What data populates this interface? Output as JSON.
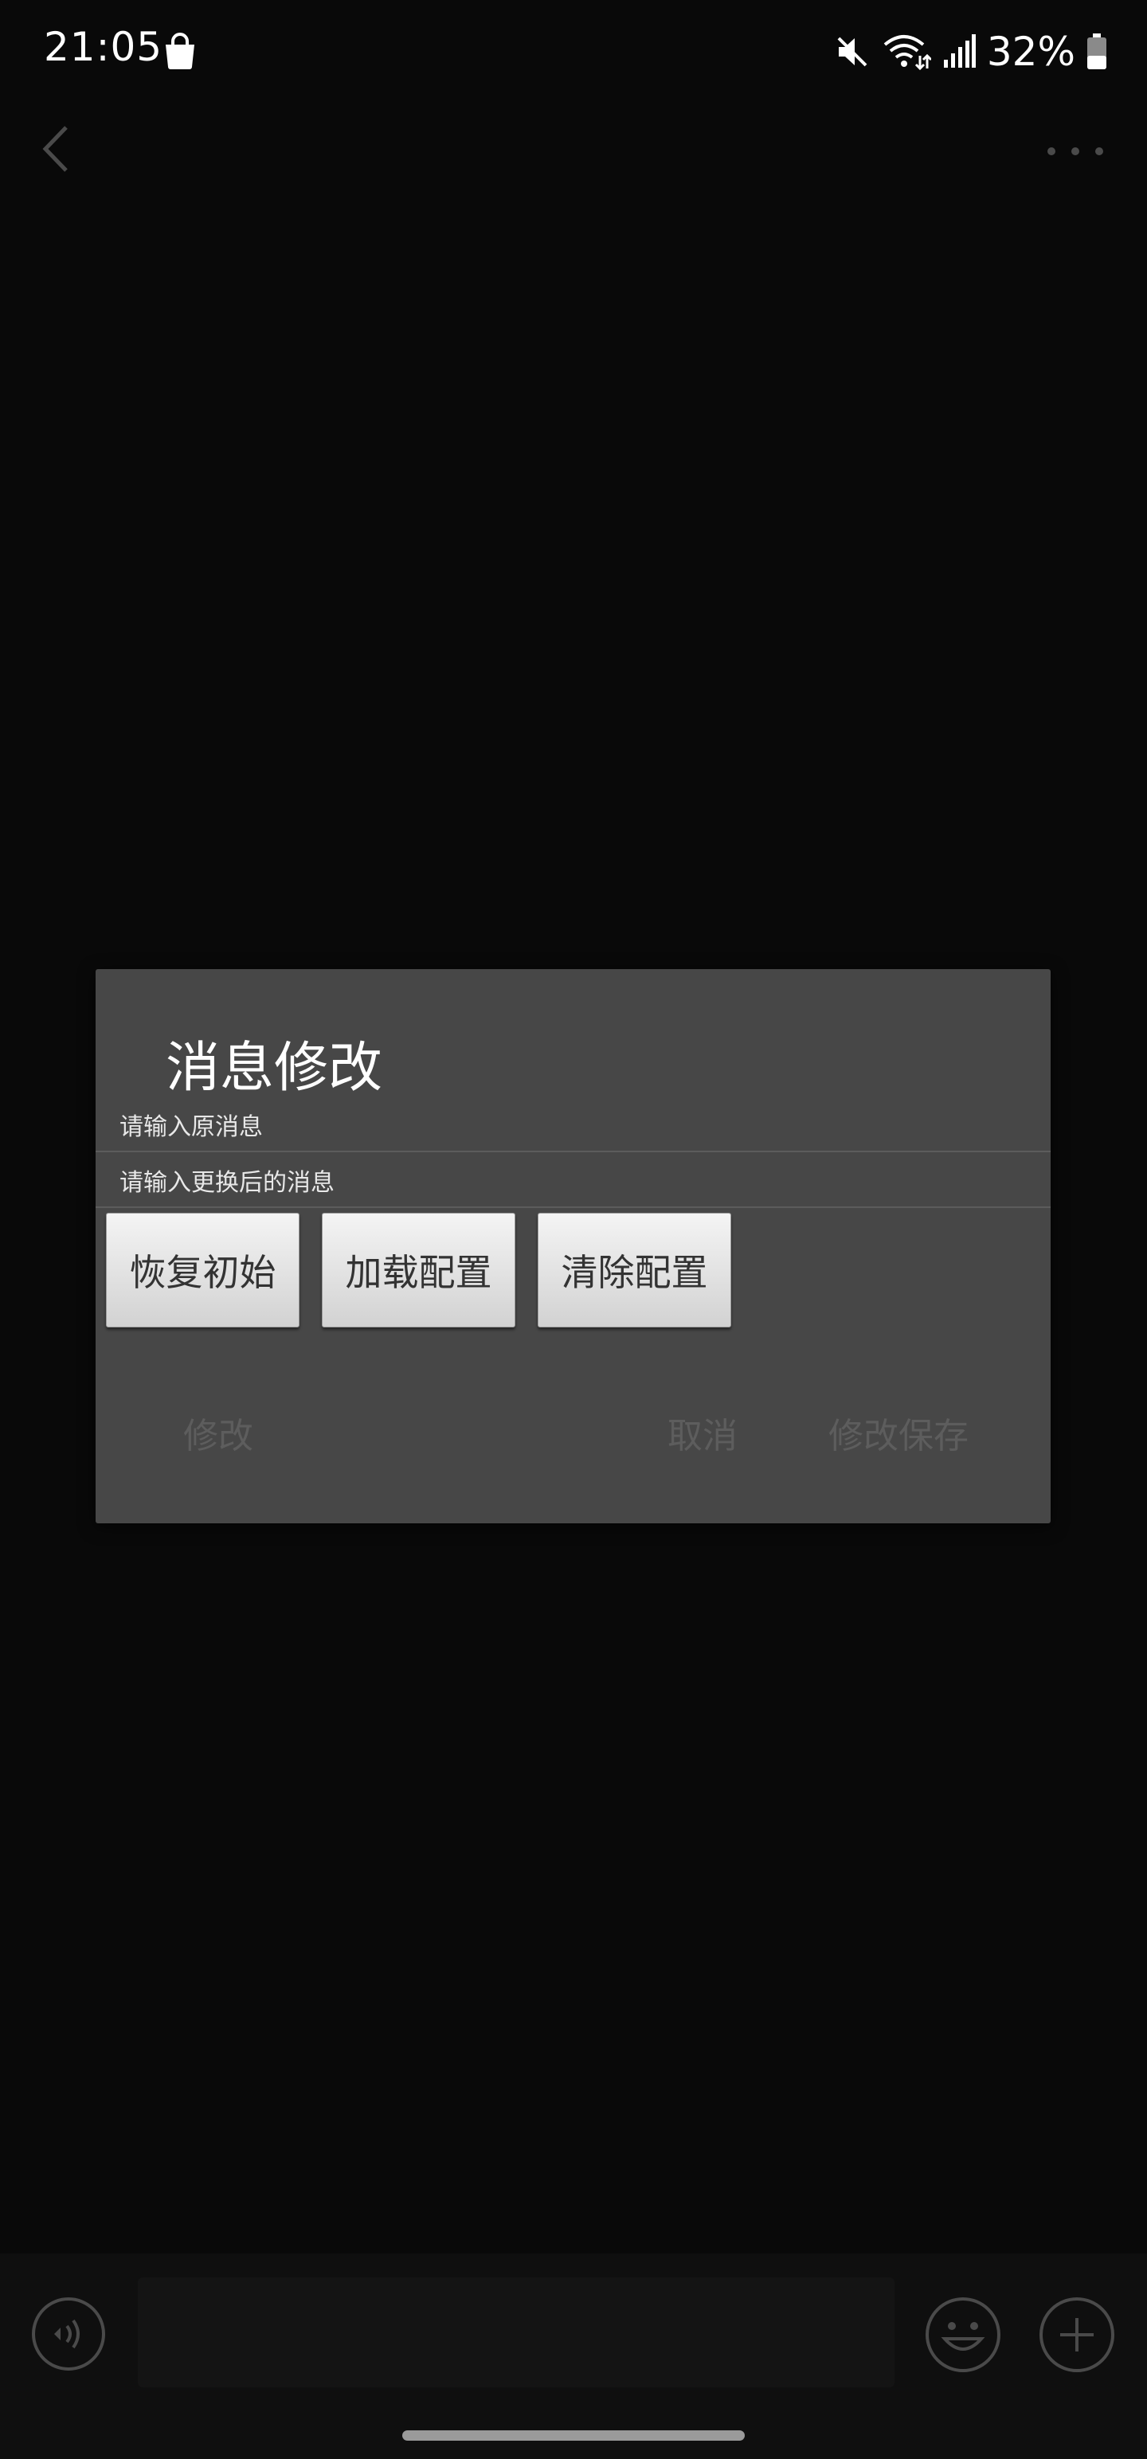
{
  "status_bar": {
    "time": "21:05",
    "battery": "32%",
    "icons": [
      "shopping-bag-icon",
      "mute-icon",
      "wifi-icon",
      "signal-icon",
      "battery-icon"
    ]
  },
  "nav": {
    "back_icon": "chevron-left-icon",
    "more_icon": "more-dots-icon"
  },
  "dialog": {
    "title": "消息修改",
    "original_field_hint": "请输入原消息",
    "replace_field_hint": "请输入更换后的消息",
    "buttons": {
      "restore": "恢复初始",
      "load": "加载配置",
      "clear": "清除配置"
    },
    "actions": {
      "modify": "修改",
      "cancel": "取消",
      "save": "修改保存"
    }
  },
  "input_bar": {
    "voice_icon": "voice-icon",
    "emoji_icon": "emoji-icon",
    "add_icon": "plus-circle-icon"
  },
  "colors": {
    "background": "#090909",
    "dialog_bg": "#474747",
    "button_bg": "#e6e6e6",
    "disabled_text": "#5d5d5d"
  }
}
